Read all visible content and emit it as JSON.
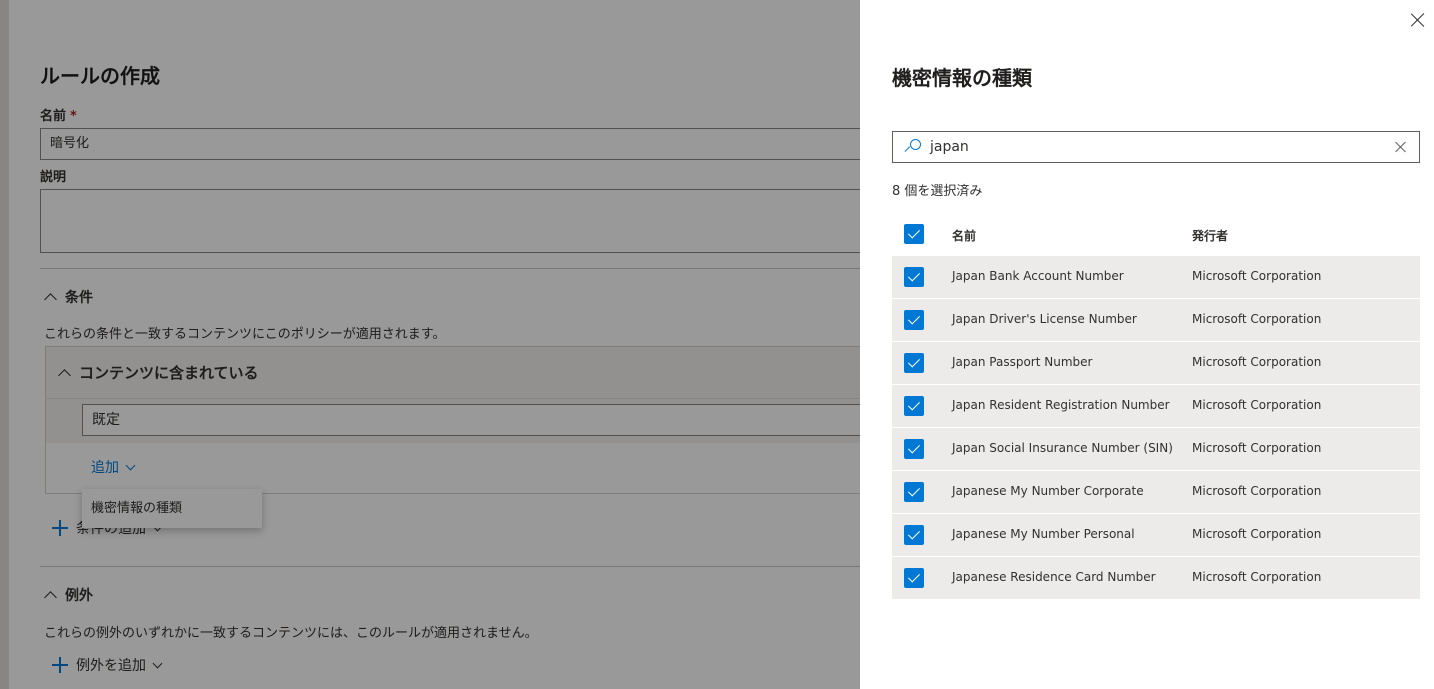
{
  "form": {
    "title": "ルールの作成",
    "name_label": "名前",
    "required_mark": "*",
    "name_value": "暗号化",
    "desc_label": "説明",
    "conditions_header": "条件",
    "conditions_desc": "これらの条件と一致するコンテンツにこのポリシーが適用されます。",
    "content_contains": "コンテンツに含まれている",
    "default_value": "既定",
    "add_label": "追加",
    "dropdown_item": "機密情報の種類",
    "add_condition": "条件の追加",
    "exceptions_header": "例外",
    "exceptions_desc": "これらの例外のいずれかに一致するコンテンツには、このルールが適用されません。",
    "add_exception": "例外を追加"
  },
  "panel": {
    "title": "機密情報の種類",
    "search_value": "japan",
    "selected_count": "8 個を選択済み",
    "col_name": "名前",
    "col_publisher": "発行者",
    "rows": [
      {
        "name": "Japan Bank Account Number",
        "publisher": "Microsoft Corporation",
        "checked": true
      },
      {
        "name": "Japan Driver's License Number",
        "publisher": "Microsoft Corporation",
        "checked": true
      },
      {
        "name": "Japan Passport Number",
        "publisher": "Microsoft Corporation",
        "checked": true
      },
      {
        "name": "Japan Resident Registration Number",
        "publisher": "Microsoft Corporation",
        "checked": true
      },
      {
        "name": "Japan Social Insurance Number (SIN)",
        "publisher": "Microsoft Corporation",
        "checked": true
      },
      {
        "name": "Japanese My Number Corporate",
        "publisher": "Microsoft Corporation",
        "checked": true
      },
      {
        "name": "Japanese My Number Personal",
        "publisher": "Microsoft Corporation",
        "checked": true
      },
      {
        "name": "Japanese Residence Card Number",
        "publisher": "Microsoft Corporation",
        "checked": true
      }
    ]
  },
  "colors": {
    "accent": "#0078d4",
    "row_bg": "#edebe9",
    "overlay": "rgba(0,0,0,0.4)"
  }
}
